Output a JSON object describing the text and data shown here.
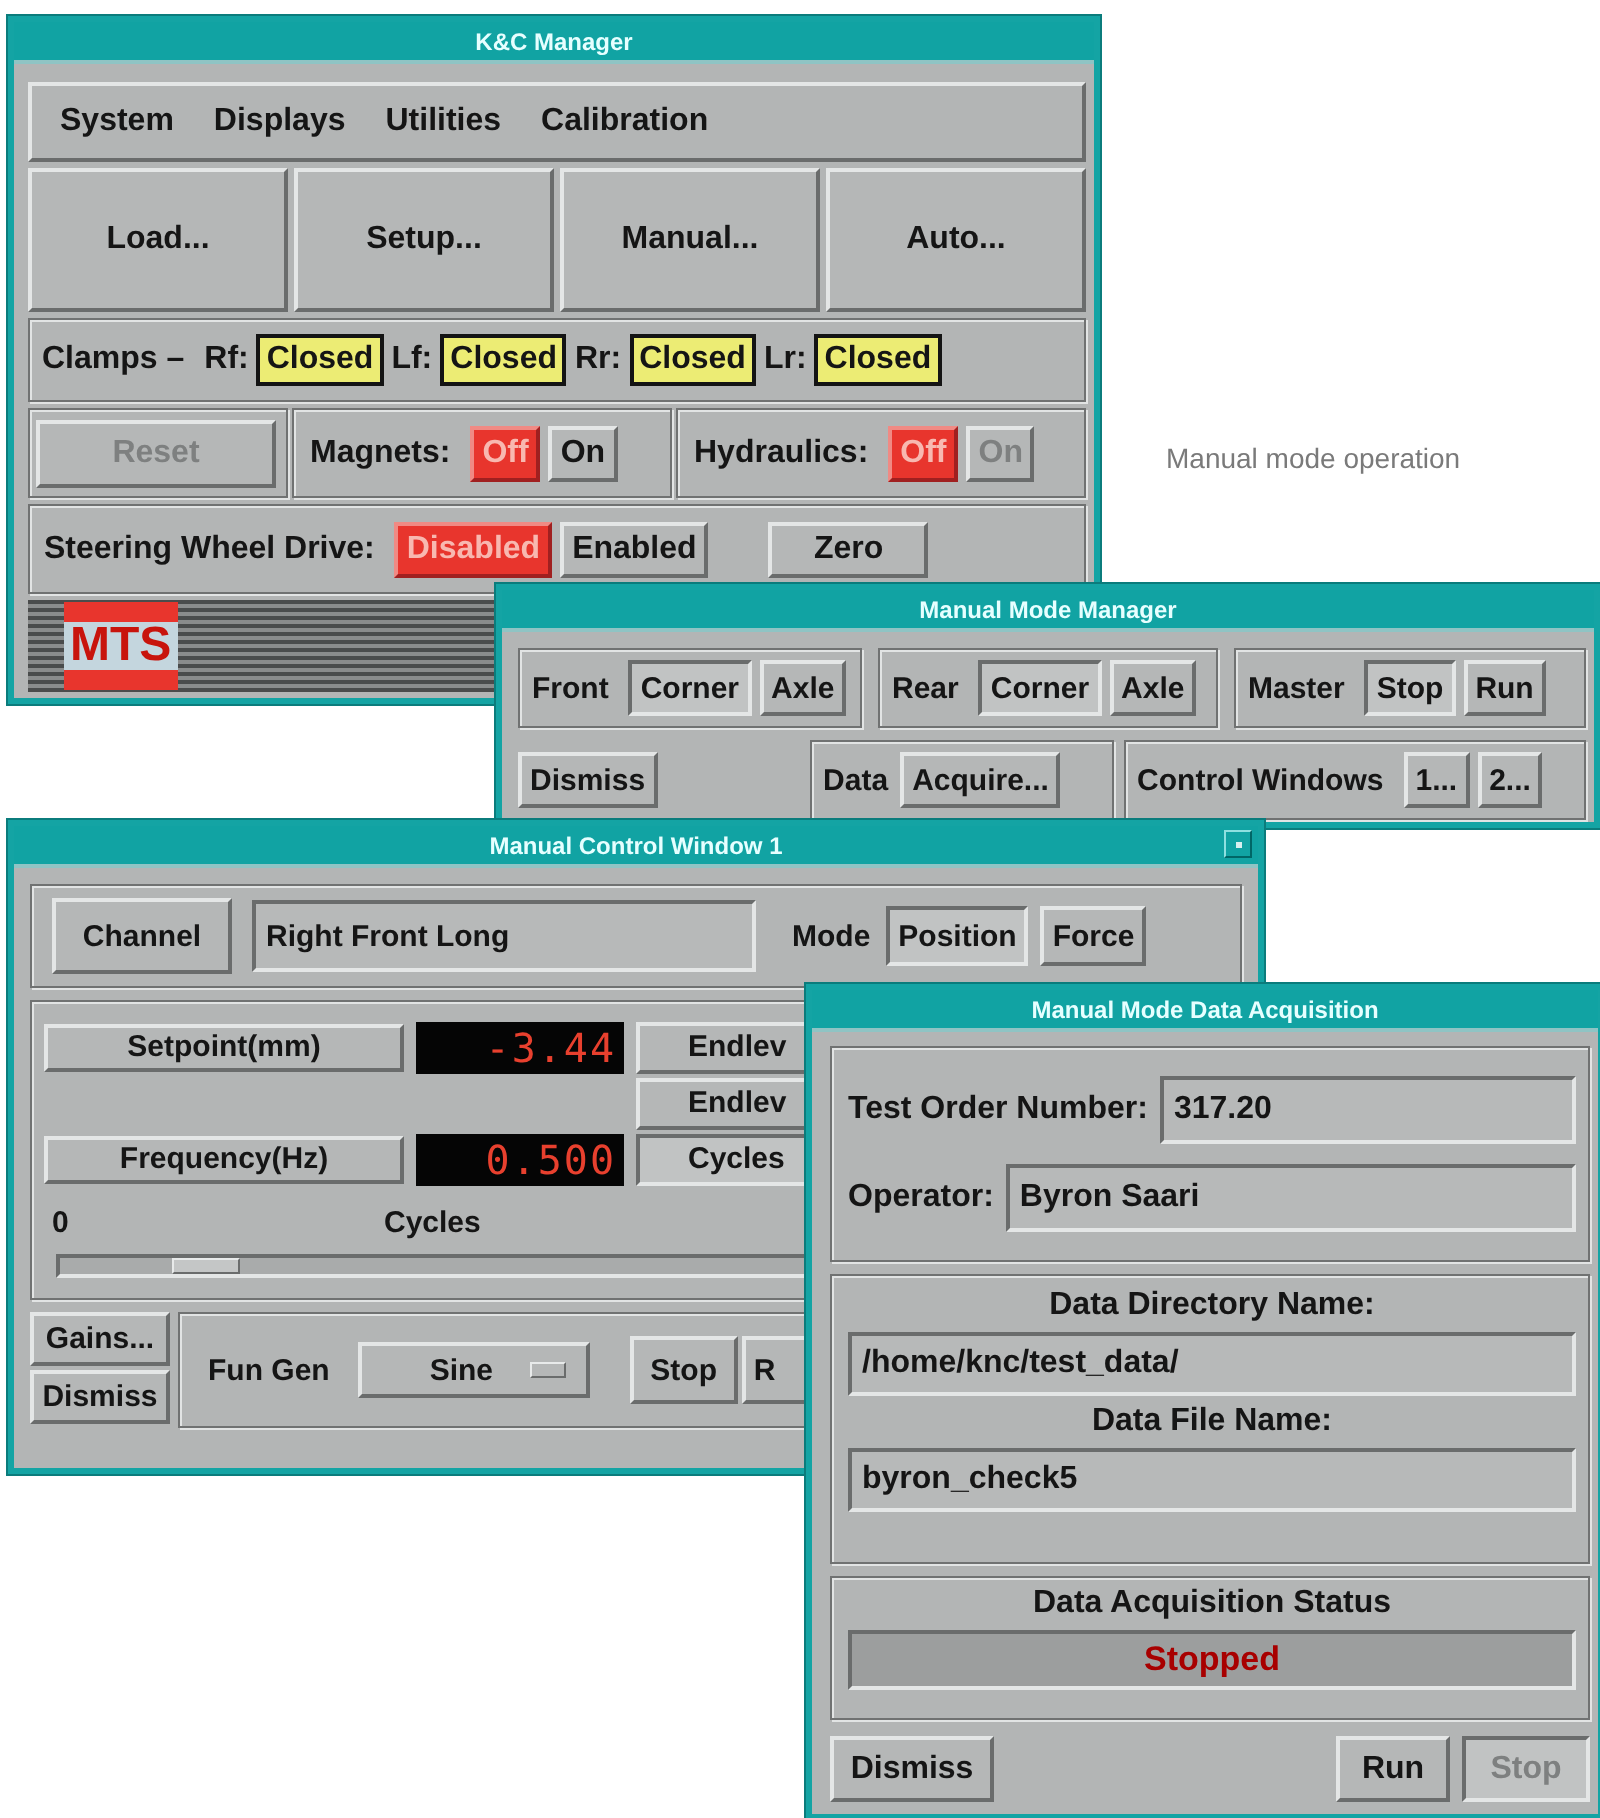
{
  "caption": "Manual mode operation",
  "kc_manager": {
    "title": "K&C Manager",
    "menu": [
      "System",
      "Displays",
      "Utilities",
      "Calibration"
    ],
    "buttons": [
      "Load...",
      "Setup...",
      "Manual...",
      "Auto..."
    ],
    "clamps": {
      "label": "Clamps –",
      "items": [
        {
          "label": "Rf:",
          "value": "Closed"
        },
        {
          "label": "Lf:",
          "value": "Closed"
        },
        {
          "label": "Rr:",
          "value": "Closed"
        },
        {
          "label": "Lr:",
          "value": "Closed"
        }
      ]
    },
    "reset": {
      "label": "Reset",
      "disabled": true
    },
    "magnets": {
      "label": "Magnets:",
      "options": [
        {
          "label": "Off",
          "selected": true,
          "disabled": false
        },
        {
          "label": "On",
          "selected": false,
          "disabled": false
        }
      ]
    },
    "hydraulics": {
      "label": "Hydraulics:",
      "options": [
        {
          "label": "Off",
          "selected": true,
          "disabled": false
        },
        {
          "label": "On",
          "selected": false,
          "disabled": true
        }
      ]
    },
    "steering": {
      "label": "Steering Wheel Drive:",
      "options": [
        {
          "label": "Disabled",
          "selected": true
        },
        {
          "label": "Enabled",
          "selected": false
        }
      ],
      "zero": "Zero"
    },
    "logo": "MTS"
  },
  "manual_mode_manager": {
    "title": "Manual Mode Manager",
    "groups": [
      {
        "label": "Front",
        "options": [
          {
            "label": "Corner",
            "selected": true
          },
          {
            "label": "Axle",
            "selected": false
          }
        ]
      },
      {
        "label": "Rear",
        "options": [
          {
            "label": "Corner",
            "selected": true
          },
          {
            "label": "Axle",
            "selected": false
          }
        ]
      },
      {
        "label": "Master",
        "options": [
          {
            "label": "Stop",
            "selected": true
          },
          {
            "label": "Run",
            "selected": false
          }
        ]
      }
    ],
    "dismiss": "Dismiss",
    "data": {
      "label": "Data",
      "button": "Acquire..."
    },
    "control_windows": {
      "label": "Control Windows",
      "buttons": [
        "1...",
        "2..."
      ]
    }
  },
  "manual_control_window": {
    "title": "Manual Control Window 1",
    "channel_button": "Channel",
    "channel_value": "Right Front Long",
    "mode": {
      "label": "Mode",
      "options": [
        {
          "label": "Position",
          "selected": true
        },
        {
          "label": "Force",
          "selected": false
        }
      ]
    },
    "setpoint": {
      "button": "Setpoint(mm)",
      "reading": "-3.44"
    },
    "frequency": {
      "button": "Frequency(Hz)",
      "reading": "0.500"
    },
    "side_buttons": [
      "Endlev",
      "Endlev",
      "Cycles"
    ],
    "slider": {
      "min_label": "0",
      "label": "Cycles",
      "level": 0.1
    },
    "gains": "Gains...",
    "dismiss": "Dismiss",
    "fun_gen": {
      "label": "Fun Gen",
      "value": "Sine"
    },
    "stop": "Stop",
    "run": "R"
  },
  "data_acquisition": {
    "title": "Manual Mode Data Acquisition",
    "fields": [
      {
        "label": "Test Order Number:",
        "value": "317.20"
      },
      {
        "label": "Operator:",
        "value": "Byron Saari"
      }
    ],
    "directory": {
      "label": "Data Directory Name:",
      "value": "/home/knc/test_data/"
    },
    "file": {
      "label": "Data File Name:",
      "value": "byron_check5"
    },
    "status": {
      "label": "Data Acquisition Status",
      "value": "Stopped"
    },
    "buttons": [
      {
        "label": "Dismiss",
        "disabled": false
      },
      {
        "label": "Run",
        "disabled": false
      },
      {
        "label": "Stop",
        "disabled": true
      }
    ]
  }
}
